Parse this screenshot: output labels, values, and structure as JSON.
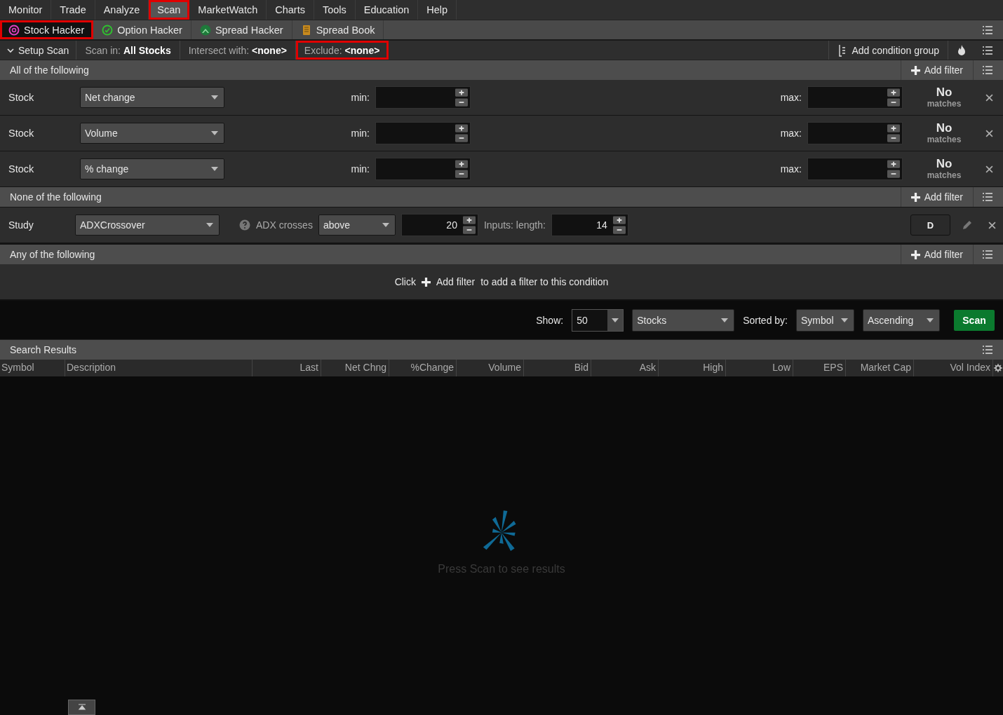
{
  "menu": [
    {
      "label": "Monitor",
      "selected": false,
      "highlighted": false
    },
    {
      "label": "Trade",
      "selected": false,
      "highlighted": false
    },
    {
      "label": "Analyze",
      "selected": false,
      "highlighted": false
    },
    {
      "label": "Scan",
      "selected": true,
      "highlighted": true
    },
    {
      "label": "MarketWatch",
      "selected": false,
      "highlighted": false
    },
    {
      "label": "Charts",
      "selected": false,
      "highlighted": false
    },
    {
      "label": "Tools",
      "selected": false,
      "highlighted": false
    },
    {
      "label": "Education",
      "selected": false,
      "highlighted": false
    },
    {
      "label": "Help",
      "selected": false,
      "highlighted": false
    }
  ],
  "hacker_tabs": [
    {
      "label": "Stock Hacker",
      "selected": true,
      "highlighted": true
    },
    {
      "label": "Option Hacker",
      "selected": false,
      "highlighted": false
    },
    {
      "label": "Spread Hacker",
      "selected": false,
      "highlighted": false
    },
    {
      "label": "Spread Book",
      "selected": false,
      "highlighted": false
    }
  ],
  "setup_bar": {
    "setup": {
      "label": "Setup Scan",
      "expanded": true
    },
    "fields": [
      {
        "label": "Scan in:",
        "value": "All Stocks",
        "highlighted": false
      },
      {
        "label": "Intersect with:",
        "value": "<none>",
        "highlighted": false
      },
      {
        "label": "Exclude:",
        "value": "<none>",
        "highlighted": true
      }
    ],
    "add_group": "Add condition group"
  },
  "groups": [
    {
      "title": "All of the following",
      "add_filter": "Add filter",
      "filters": [
        {
          "kind": "stock",
          "label": "Stock",
          "field": "Net change",
          "min_label": "min:",
          "max_label": "max:",
          "result": "No",
          "result_sub": "matches"
        },
        {
          "kind": "stock",
          "label": "Stock",
          "field": "Volume",
          "min_label": "min:",
          "max_label": "max:",
          "result": "No",
          "result_sub": "matches"
        },
        {
          "kind": "stock",
          "label": "Stock",
          "field": "% change",
          "min_label": "min:",
          "max_label": "max:",
          "result": "No",
          "result_sub": "matches"
        }
      ]
    },
    {
      "title": "None of the following",
      "add_filter": "Add filter",
      "filters": [
        {
          "kind": "study",
          "label": "Study",
          "field": "ADXCrossover",
          "param_label": "ADX crosses",
          "param_choice": "above",
          "param_value": "20",
          "input_label": "Inputs: length:",
          "input_value": "14",
          "aggregation": "D"
        }
      ]
    },
    {
      "title": "Any of the following",
      "add_filter": "Add filter",
      "empty_hint": {
        "before": "Click",
        "action": "Add filter",
        "after": "to add a filter to this condition"
      }
    }
  ],
  "options": {
    "show_label": "Show:",
    "show_value": "50",
    "type": "Stocks",
    "sort_label": "Sorted by:",
    "sort_field": "Symbol",
    "sort_order": "Ascending",
    "scan_button": "Scan"
  },
  "results": {
    "title": "Search Results",
    "columns": [
      "Symbol",
      "Description",
      "Last",
      "Net Chng",
      "%Change",
      "Volume",
      "Bid",
      "Ask",
      "High",
      "Low",
      "EPS",
      "Market Cap",
      "Vol Index"
    ],
    "empty_message": "Press Scan to see results"
  }
}
